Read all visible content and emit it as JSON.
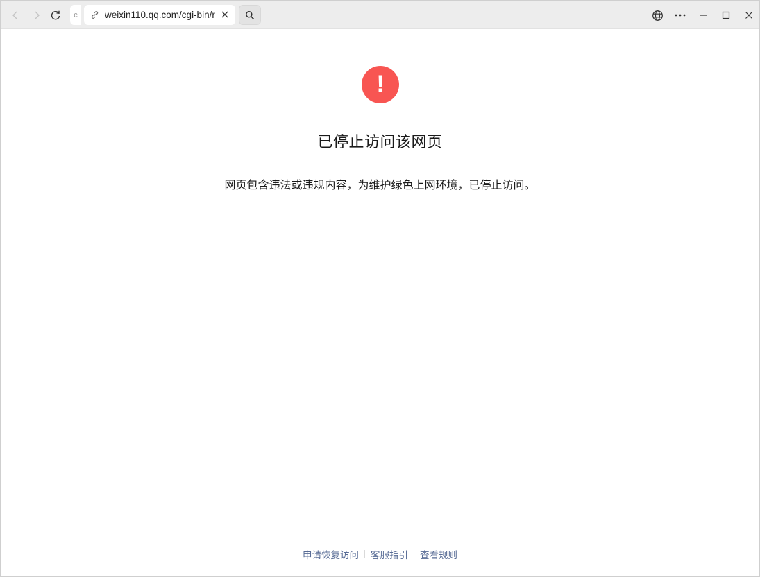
{
  "browser": {
    "tab_stub_text": "c",
    "url": "weixin110.qq.com/cgi-bin/r",
    "icons": {
      "back": "chevron-left-icon",
      "forward": "chevron-right-icon",
      "reload": "reload-icon",
      "link": "link-icon",
      "clear": "close-icon",
      "search": "search-icon",
      "translate": "globe-icon",
      "more": "more-horizontal-icon",
      "minimize": "minimize-icon",
      "maximize": "maximize-icon",
      "close": "close-icon"
    }
  },
  "page": {
    "icon": "alert-icon",
    "icon_color": "#f85552",
    "icon_glyph": "!",
    "title": "已停止访问该网页",
    "description": "网页包含违法或违规内容，为维护绿色上网环境，已停止访问。",
    "footer": {
      "links": [
        "申请恢复访问",
        "客服指引",
        "查看规则"
      ],
      "link_color": "#576b95"
    }
  }
}
